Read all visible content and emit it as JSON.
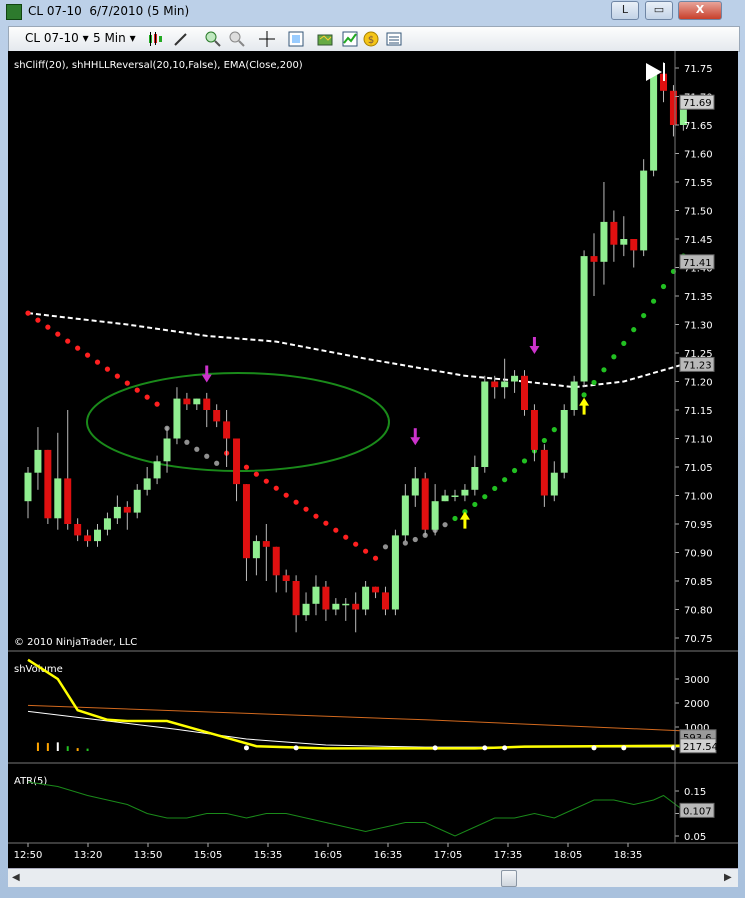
{
  "window": {
    "title": "CL 07-10  6/7/2010 (5 Min)",
    "buttons": {
      "minimize": "L",
      "maximize": "▭",
      "close": "X"
    }
  },
  "toolbar": {
    "instrument": "CL 07-10",
    "interval": "5 Min",
    "icons": [
      "candlestick-icon",
      "draw-pencil-icon",
      "zoom-in-icon",
      "zoom-out-icon",
      "crosshair-icon",
      "properties-icon",
      "strategy-icon",
      "chart-trader-icon",
      "money-icon",
      "data-box-icon"
    ]
  },
  "chart": {
    "indicator_label": "shCliff(20), shHHLLReversal(20,10,False), EMA(Close,200)",
    "copyright": "© 2010 NinjaTrader, LLC",
    "price_ticks": [
      "71.75",
      "71.70",
      "71.65",
      "71.60",
      "71.55",
      "71.50",
      "71.45",
      "71.40",
      "71.35",
      "71.30",
      "71.25",
      "71.20",
      "71.15",
      "71.10",
      "71.05",
      "71.00",
      "70.95",
      "70.90",
      "70.85",
      "70.80",
      "70.75"
    ],
    "price_tick_values": [
      71.75,
      71.7,
      71.65,
      71.6,
      71.55,
      71.5,
      71.45,
      71.4,
      71.35,
      71.3,
      71.25,
      71.2,
      71.15,
      71.1,
      71.05,
      71.0,
      70.95,
      70.9,
      70.85,
      70.8,
      70.75
    ],
    "last_price_label": "71.69",
    "trail_stop_label": "71.41",
    "ema_label": "71.23",
    "colors": {
      "up": "#90ee90",
      "down": "#e01010",
      "ema": "#ffffff",
      "stop_red": "#ff2020",
      "stop_green": "#22c022",
      "stop_gray": "#909090",
      "ellipse": "#1a8a1a",
      "down_arrow": "#cc33cc",
      "up_arrow": "#ffff00"
    }
  },
  "volume_panel": {
    "label": "shVolume",
    "ticks": [
      "3000",
      "2000",
      "1000"
    ],
    "value_labels": [
      "593.6",
      "217.54"
    ]
  },
  "atr_panel": {
    "label": "ATR(5)",
    "ticks": [
      "0.15",
      "0.1",
      "0.05"
    ],
    "value_label": "0.107"
  },
  "time_axis": [
    "12:50",
    "13:20",
    "13:50",
    "15:05",
    "15:35",
    "16:05",
    "16:35",
    "17:05",
    "17:35",
    "18:05",
    "18:35"
  ],
  "chart_data": {
    "type": "candlestick",
    "price_axis": [
      70.75,
      71.75
    ],
    "candles": [
      [
        70.99,
        71.04,
        70.96,
        71.05
      ],
      [
        71.04,
        71.08,
        71.01,
        71.12
      ],
      [
        71.08,
        70.96,
        70.95,
        71.08
      ],
      [
        70.96,
        71.03,
        70.94,
        71.11
      ],
      [
        71.03,
        70.95,
        70.94,
        71.15
      ],
      [
        70.95,
        70.93,
        70.92,
        70.96
      ],
      [
        70.93,
        70.92,
        70.91,
        70.94
      ],
      [
        70.92,
        70.94,
        70.91,
        70.95
      ],
      [
        70.94,
        70.96,
        70.93,
        70.97
      ],
      [
        70.96,
        70.98,
        70.95,
        71.0
      ],
      [
        70.98,
        70.97,
        70.94,
        70.99
      ],
      [
        70.97,
        71.01,
        70.96,
        71.02
      ],
      [
        71.01,
        71.03,
        71.0,
        71.05
      ],
      [
        71.03,
        71.06,
        71.02,
        71.07
      ],
      [
        71.06,
        71.1,
        71.04,
        71.12
      ],
      [
        71.1,
        71.17,
        71.09,
        71.19
      ],
      [
        71.17,
        71.16,
        71.15,
        71.18
      ],
      [
        71.16,
        71.17,
        71.15,
        71.17
      ],
      [
        71.17,
        71.15,
        71.12,
        71.18
      ],
      [
        71.15,
        71.13,
        71.12,
        71.16
      ],
      [
        71.13,
        71.1,
        71.05,
        71.15
      ],
      [
        71.1,
        71.02,
        70.99,
        71.1
      ],
      [
        71.02,
        70.89,
        70.85,
        71.02
      ],
      [
        70.89,
        70.92,
        70.86,
        70.93
      ],
      [
        70.92,
        70.91,
        70.85,
        70.95
      ],
      [
        70.91,
        70.86,
        70.83,
        70.91
      ],
      [
        70.86,
        70.85,
        70.83,
        70.87
      ],
      [
        70.85,
        70.79,
        70.76,
        70.86
      ],
      [
        70.79,
        70.81,
        70.78,
        70.83
      ],
      [
        70.81,
        70.84,
        70.79,
        70.86
      ],
      [
        70.84,
        70.8,
        70.78,
        70.85
      ],
      [
        70.8,
        70.81,
        70.79,
        70.82
      ],
      [
        70.81,
        70.81,
        70.78,
        70.82
      ],
      [
        70.81,
        70.8,
        70.76,
        70.83
      ],
      [
        70.8,
        70.84,
        70.79,
        70.85
      ],
      [
        70.84,
        70.83,
        70.82,
        70.84
      ],
      [
        70.83,
        70.8,
        70.79,
        70.84
      ],
      [
        70.8,
        70.93,
        70.79,
        70.94
      ],
      [
        70.93,
        71.0,
        70.92,
        71.02
      ],
      [
        71.0,
        71.03,
        70.98,
        71.05
      ],
      [
        71.03,
        70.94,
        70.93,
        71.04
      ],
      [
        70.94,
        70.99,
        70.93,
        71.02
      ],
      [
        70.99,
        71.0,
        70.99,
        71.01
      ],
      [
        71.0,
        71.0,
        70.99,
        71.01
      ],
      [
        71.0,
        71.01,
        70.99,
        71.02
      ],
      [
        71.01,
        71.05,
        71.0,
        71.07
      ],
      [
        71.05,
        71.2,
        71.04,
        71.21
      ],
      [
        71.2,
        71.19,
        71.17,
        71.21
      ],
      [
        71.19,
        71.2,
        71.17,
        71.24
      ],
      [
        71.2,
        71.21,
        71.18,
        71.22
      ],
      [
        71.21,
        71.15,
        71.14,
        71.22
      ],
      [
        71.15,
        71.08,
        71.06,
        71.16
      ],
      [
        71.08,
        71.0,
        70.98,
        71.09
      ],
      [
        71.0,
        71.04,
        70.99,
        71.06
      ],
      [
        71.04,
        71.15,
        71.03,
        71.16
      ],
      [
        71.15,
        71.2,
        71.14,
        71.21
      ],
      [
        71.2,
        71.42,
        71.19,
        71.43
      ],
      [
        71.42,
        71.41,
        71.35,
        71.46
      ],
      [
        71.41,
        71.48,
        71.37,
        71.55
      ],
      [
        71.48,
        71.44,
        71.41,
        71.5
      ],
      [
        71.44,
        71.45,
        71.42,
        71.49
      ],
      [
        71.45,
        71.43,
        71.4,
        71.44
      ],
      [
        71.43,
        71.57,
        71.42,
        71.59
      ],
      [
        71.57,
        71.74,
        71.56,
        71.75
      ],
      [
        71.74,
        71.71,
        71.69,
        71.76
      ],
      [
        71.71,
        71.65,
        71.63,
        71.72
      ],
      [
        71.65,
        71.69,
        71.64,
        71.7
      ]
    ]
  }
}
